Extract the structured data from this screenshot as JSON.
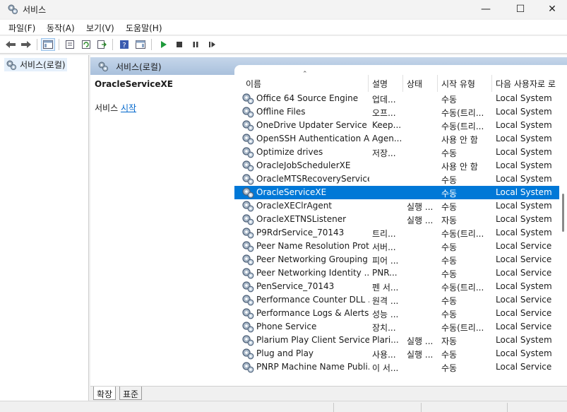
{
  "window": {
    "title": "서비스",
    "minimize": "—",
    "maximize": "☐",
    "close": "✕"
  },
  "menu": [
    "파일(F)",
    "동작(A)",
    "보기(V)",
    "도움말(H)"
  ],
  "toolbar": {
    "icons": [
      "back-arrow-icon",
      "forward-arrow-icon",
      "show-console-tree-icon",
      "properties-icon",
      "refresh-icon",
      "export-list-icon",
      "help-icon",
      "action-pane-icon",
      "start-service-icon",
      "stop-service-icon",
      "pause-service-icon",
      "resume-service-icon"
    ]
  },
  "tree": {
    "item_label": "서비스(로컬)"
  },
  "content": {
    "header_title": "서비스(로컬)",
    "selected_service": "OracleServiceXE",
    "action_prefix": "서비스 ",
    "action_link": "시작"
  },
  "columns": {
    "name": "이름",
    "description": "설명",
    "status": "상태",
    "startup": "시작 유형",
    "logon": "다음 사용자로 로"
  },
  "services": [
    {
      "name": "Office 64 Source Engine",
      "desc": "업데...",
      "status": "",
      "startup": "수동",
      "logon": "Local System"
    },
    {
      "name": "Offline Files",
      "desc": "오프...",
      "status": "",
      "startup": "수동(트리...",
      "logon": "Local System"
    },
    {
      "name": "OneDrive Updater Service",
      "desc": "Keep...",
      "status": "",
      "startup": "수동(트리...",
      "logon": "Local System"
    },
    {
      "name": "OpenSSH Authentication A...",
      "desc": "Agen...",
      "status": "",
      "startup": "사용 안 함",
      "logon": "Local System"
    },
    {
      "name": "Optimize drives",
      "desc": "저장...",
      "status": "",
      "startup": "수동",
      "logon": "Local System"
    },
    {
      "name": "OracleJobSchedulerXE",
      "desc": "",
      "status": "",
      "startup": "사용 안 함",
      "logon": "Local System"
    },
    {
      "name": "OracleMTSRecoveryService",
      "desc": "",
      "status": "",
      "startup": "수동",
      "logon": "Local System"
    },
    {
      "name": "OracleServiceXE",
      "desc": "",
      "status": "",
      "startup": "수동",
      "logon": "Local System",
      "selected": true
    },
    {
      "name": "OracleXEClrAgent",
      "desc": "",
      "status": "실행 ...",
      "startup": "수동",
      "logon": "Local System"
    },
    {
      "name": "OracleXETNSListener",
      "desc": "",
      "status": "실행 ...",
      "startup": "자동",
      "logon": "Local System"
    },
    {
      "name": "P9RdrService_70143",
      "desc": "트리...",
      "status": "",
      "startup": "수동(트리...",
      "logon": "Local System"
    },
    {
      "name": "Peer Name Resolution Prot...",
      "desc": "서버...",
      "status": "",
      "startup": "수동",
      "logon": "Local Service"
    },
    {
      "name": "Peer Networking Grouping",
      "desc": "피어 ...",
      "status": "",
      "startup": "수동",
      "logon": "Local Service"
    },
    {
      "name": "Peer Networking Identity ...",
      "desc": "PNR...",
      "status": "",
      "startup": "수동",
      "logon": "Local Service"
    },
    {
      "name": "PenService_70143",
      "desc": "펜 서...",
      "status": "",
      "startup": "수동(트리...",
      "logon": "Local System"
    },
    {
      "name": "Performance Counter DLL ...",
      "desc": "원격 ...",
      "status": "",
      "startup": "수동",
      "logon": "Local Service"
    },
    {
      "name": "Performance Logs & Alerts",
      "desc": "성능 ...",
      "status": "",
      "startup": "수동",
      "logon": "Local Service"
    },
    {
      "name": "Phone Service",
      "desc": "장치...",
      "status": "",
      "startup": "수동(트리...",
      "logon": "Local Service"
    },
    {
      "name": "Plarium Play Client Service",
      "desc": "Plari...",
      "status": "실행 ...",
      "startup": "자동",
      "logon": "Local System"
    },
    {
      "name": "Plug and Play",
      "desc": "사용...",
      "status": "실행 ...",
      "startup": "수동",
      "logon": "Local System"
    },
    {
      "name": "PNRP Machine Name Publi...",
      "desc": "이 서...",
      "status": "",
      "startup": "수동",
      "logon": "Local Service"
    }
  ],
  "tabs": [
    "확장",
    "표준"
  ],
  "colors": {
    "selection": "#0078d7",
    "header_gradient_top": "#c5d6ea",
    "header_gradient_bottom": "#a9c0dc",
    "link": "#0066cc"
  }
}
